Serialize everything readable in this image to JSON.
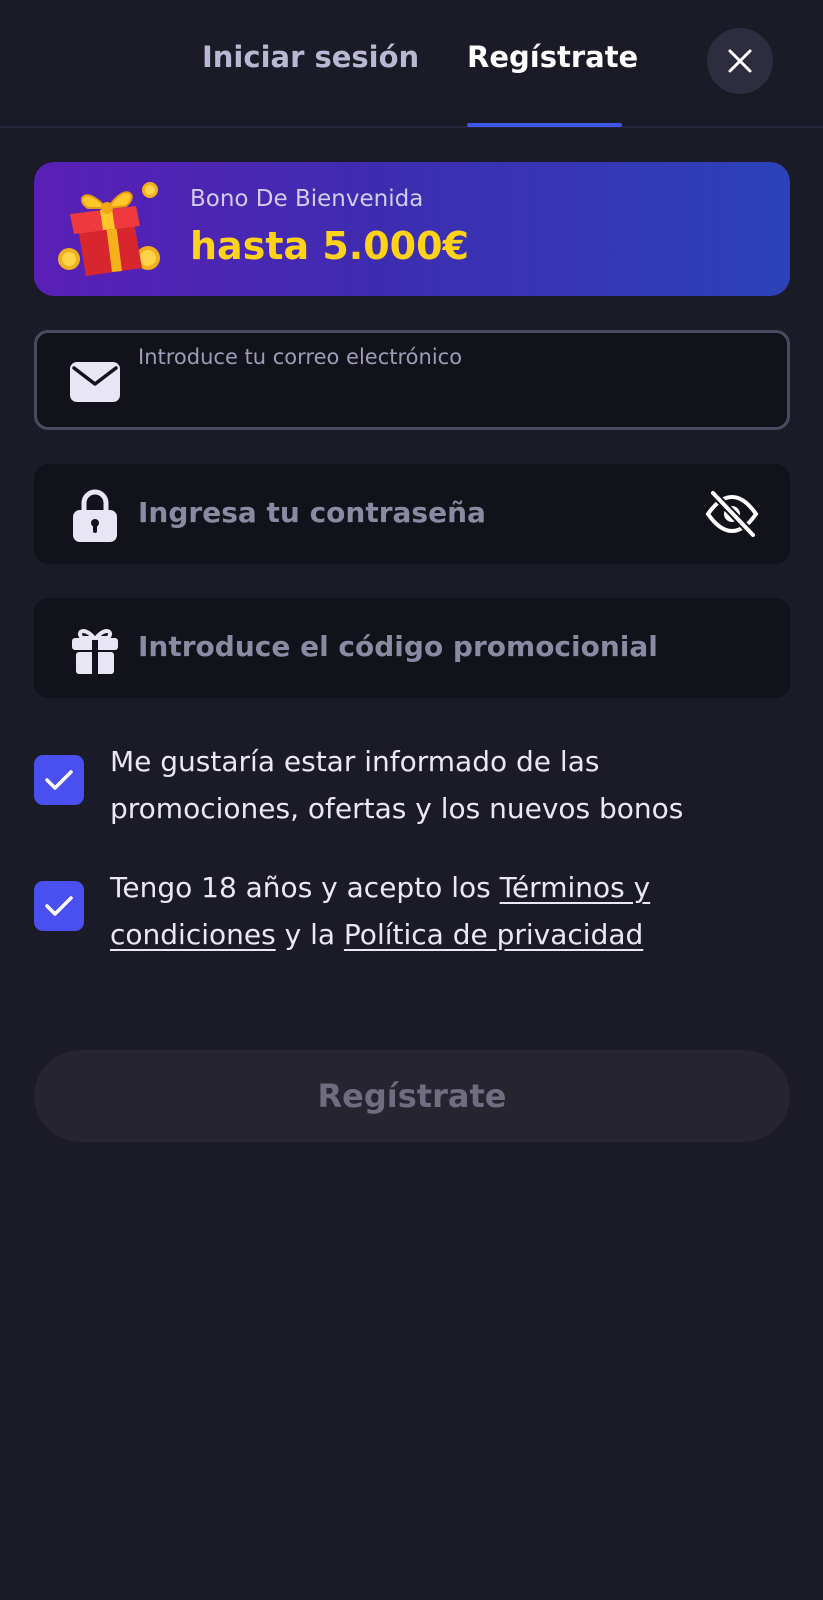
{
  "header": {
    "tabs": [
      {
        "label": "Iniciar sesión",
        "active": false
      },
      {
        "label": "Regístrate",
        "active": true
      }
    ],
    "close_icon": "close-icon"
  },
  "banner": {
    "label": "Bono De Bienvenida",
    "amount": "hasta 5.000€",
    "icon": "gift-icon"
  },
  "form": {
    "email": {
      "label": "Introduce tu correo electrónico",
      "value": "",
      "icon": "mail-icon"
    },
    "password": {
      "placeholder": "Ingresa tu contraseña",
      "icon": "lock-icon",
      "toggle_icon": "eye-off-icon"
    },
    "promo": {
      "placeholder": "Introduce el código promocionial",
      "icon": "gift-icon"
    },
    "consents": [
      {
        "checked": true,
        "text": "Me gustaría estar informado de las promociones, ofertas y los nuevos bonos"
      },
      {
        "checked": true,
        "text_before": "Tengo 18 años y acepto los ",
        "link1": "Términos y condiciones",
        "text_middle": " y la ",
        "link2": "Política de privacidad"
      }
    ],
    "submit_label": "Regístrate"
  },
  "colors": {
    "background": "#1b1a27",
    "accent": "#4950ef",
    "banner_amount": "#ffd21a"
  }
}
